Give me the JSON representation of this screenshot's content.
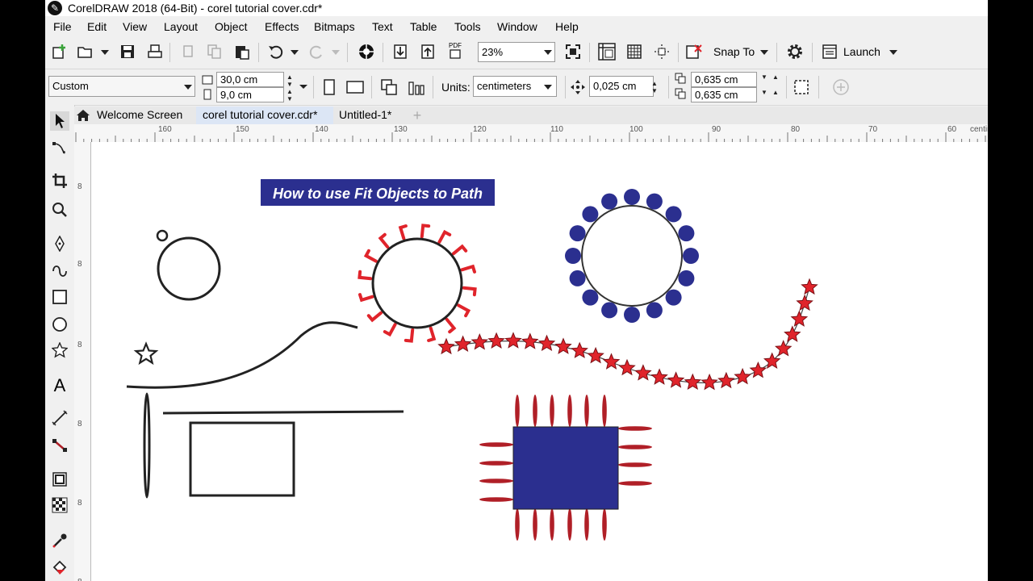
{
  "window": {
    "title": "CorelDRAW 2018 (64-Bit) - corel tutorial cover.cdr*"
  },
  "menu": [
    "File",
    "Edit",
    "View",
    "Layout",
    "Object",
    "Effects",
    "Bitmaps",
    "Text",
    "Table",
    "Tools",
    "Window",
    "Help"
  ],
  "toolbar": {
    "zoom_value": "23%",
    "snap_to_label": "Snap To",
    "launch_label": "Launch",
    "pdf_label": "PDF"
  },
  "property_bar": {
    "page_preset": "Custom",
    "width": "30,0 cm",
    "height": "9,0 cm",
    "units_label": "Units:",
    "units_value": "centimeters",
    "nudge": "0,025 cm",
    "dup_x": "0,635 cm",
    "dup_y": "0,635 cm"
  },
  "tabs": [
    {
      "label": "Welcome Screen",
      "active": false
    },
    {
      "label": "corel tutorial cover.cdr*",
      "active": true
    },
    {
      "label": "Untitled-1*",
      "active": false
    }
  ],
  "ruler": {
    "top_labels": [
      "160",
      "150",
      "140",
      "130",
      "120",
      "110",
      "100",
      "90",
      "80",
      "70",
      "60",
      "centimeters"
    ],
    "left_labels": [
      "8",
      "8",
      "8",
      "8",
      "8",
      "8"
    ]
  },
  "canvas": {
    "banner_text": "How to use Fit Objects to Path"
  },
  "colors": {
    "navy": "#2b2f8f",
    "red": "#e0242b",
    "dark_red": "#b01f27",
    "accent_tab": "#dce6f5"
  },
  "icons": [
    "new-doc-icon",
    "open-icon",
    "save-icon",
    "print-icon",
    "cut-icon",
    "copy-icon",
    "paste-icon",
    "undo-icon",
    "redo-icon",
    "corel-connect-icon",
    "import-icon",
    "export-icon",
    "pdf-icon",
    "full-screen-icon",
    "show-rulers-icon",
    "show-grid-icon",
    "show-guidelines-icon",
    "snap-off-icon",
    "options-gear-icon",
    "launch-icon",
    "home-icon",
    "add-tab-icon",
    "pick-tool-icon",
    "shape-tool-icon",
    "crop-tool-icon",
    "zoom-tool-icon",
    "freehand-tool-icon",
    "artistic-media-icon",
    "rectangle-tool-icon",
    "ellipse-tool-icon",
    "polygon-tool-icon",
    "text-tool-icon",
    "parallel-dimension-icon",
    "connector-tool-icon",
    "drop-shadow-icon",
    "transparency-icon",
    "eyedropper-icon",
    "fill-icon"
  ]
}
